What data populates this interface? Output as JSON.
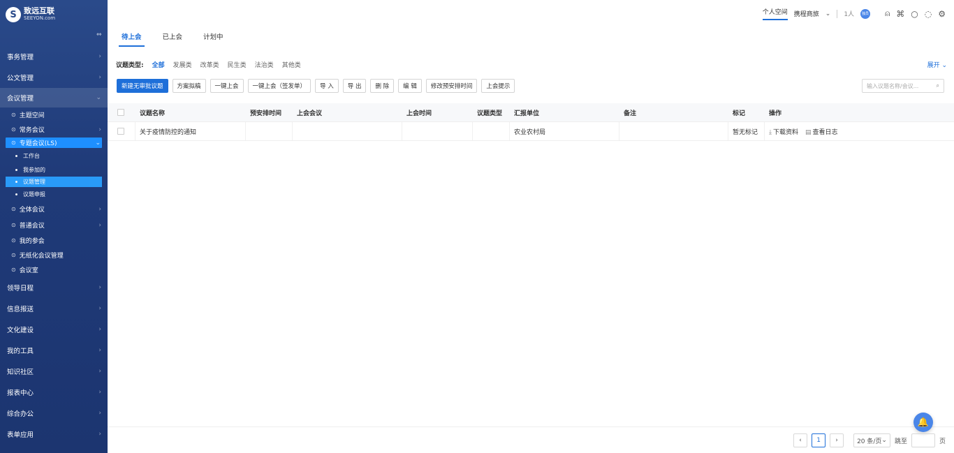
{
  "logo": {
    "mark": "S",
    "cn": "致远互联",
    "en": "SEEYON.com"
  },
  "sidebar": {
    "top_items": [
      {
        "label": "事务管理"
      },
      {
        "label": "公文管理"
      },
      {
        "label": "会议管理"
      }
    ],
    "meeting_sub": [
      {
        "label": "主题空间"
      },
      {
        "label": "常务会议"
      },
      {
        "label": "专题会议(LS)"
      }
    ],
    "topic_leaves": [
      {
        "label": "工作台"
      },
      {
        "label": "我参加的"
      },
      {
        "label": "议题管理"
      },
      {
        "label": "议题申报"
      }
    ],
    "meeting_sub2": [
      {
        "label": "全体会议"
      },
      {
        "label": "普通会议"
      },
      {
        "label": "我的参会"
      },
      {
        "label": "无纸化会议管理"
      },
      {
        "label": "会议室"
      }
    ],
    "bottom_items": [
      {
        "label": "领导日程"
      },
      {
        "label": "信息报送"
      },
      {
        "label": "文化建设"
      },
      {
        "label": "我的工具"
      },
      {
        "label": "知识社区"
      },
      {
        "label": "报表中心"
      },
      {
        "label": "综合办公"
      },
      {
        "label": "表单应用"
      }
    ]
  },
  "topbar": {
    "personal_space": "个人空间",
    "travel": "携程商旅",
    "user_count": "1人",
    "badge": "独员"
  },
  "tabs": [
    {
      "label": "待上会"
    },
    {
      "label": "已上会"
    },
    {
      "label": "计划中"
    }
  ],
  "filter": {
    "label": "议题类型:",
    "options": [
      "全部",
      "发展类",
      "改革类",
      "民生类",
      "法治类",
      "其他类"
    ],
    "expand": "展开"
  },
  "toolbar": {
    "buttons": [
      "新建无审批议题",
      "方案拟稿",
      "一键上会",
      "一键上会（签发单）",
      "导 入",
      "导 出",
      "删 除",
      "编 辑",
      "修改预安排时间",
      "上会提示"
    ]
  },
  "search": {
    "placeholder": "输入议题名称/会议..."
  },
  "table": {
    "headers": [
      "议题名称",
      "预安排时间",
      "上会会议",
      "上会时间",
      "议题类型",
      "汇报单位",
      "备注",
      "标记",
      "操作"
    ],
    "rows": [
      {
        "name": "关于疫情防控的通知",
        "pre_time": "",
        "meeting": "",
        "meeting_time": "",
        "type": "",
        "unit": "农业农村局",
        "remark": "",
        "mark": "暂无标记",
        "op_download": "下载资料",
        "op_log": "查看日志"
      }
    ]
  },
  "pager": {
    "current": "1",
    "size": "20 条/页",
    "jump_label": "跳至",
    "page_unit": "页"
  }
}
